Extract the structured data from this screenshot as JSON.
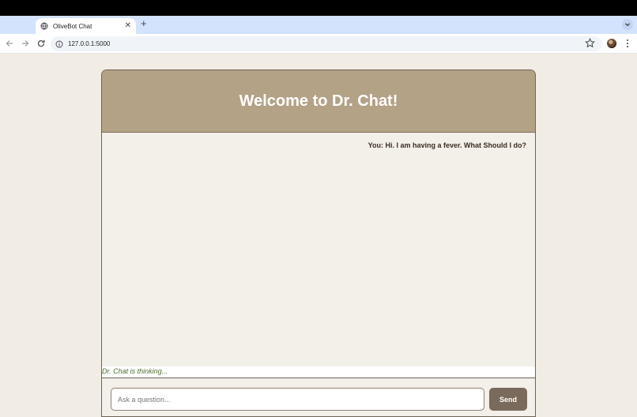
{
  "browser": {
    "tab": {
      "title": "OliveBot Chat",
      "close_glyph": "✕",
      "favicon": "globe-icon"
    },
    "new_tab_glyph": "+",
    "address": {
      "url": "127.0.0.1:5000",
      "site_info_icon": "info-icon"
    },
    "icons": {
      "back": "back-arrow-icon",
      "forward": "forward-arrow-icon",
      "reload": "reload-icon",
      "bookmark": "star-icon",
      "menu": "kebab-menu-icon",
      "tab_search": "chevron-down-icon"
    }
  },
  "chat": {
    "header_title": "Welcome to Dr. Chat!",
    "messages": [
      {
        "sender": "user",
        "text": "You: Hi. I am having a fever. What Should I do?"
      }
    ],
    "status_text": "Dr. Chat is thinking...",
    "input": {
      "placeholder": "Ask a question...",
      "value": ""
    },
    "send_label": "Send"
  },
  "colors": {
    "page_bg": "#f1ece4",
    "header_bg": "#b3a285",
    "send_bg": "#7a6a5c",
    "status_text": "#4b6a2e"
  }
}
